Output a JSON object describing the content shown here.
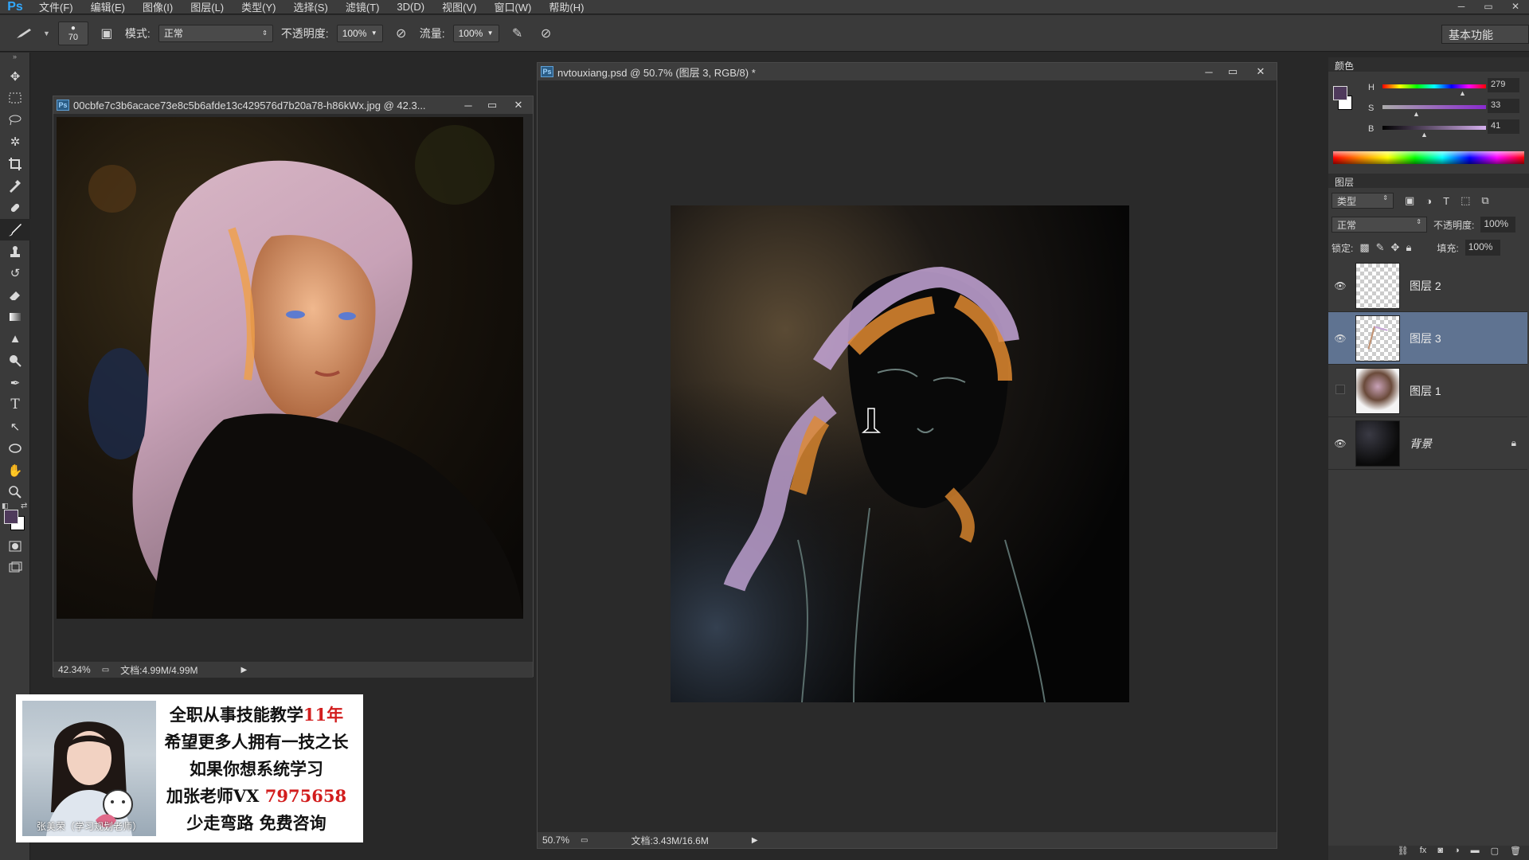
{
  "app": {
    "logo": "Ps"
  },
  "menu": [
    "文件(F)",
    "编辑(E)",
    "图像(I)",
    "图层(L)",
    "类型(Y)",
    "选择(S)",
    "滤镜(T)",
    "3D(D)",
    "视图(V)",
    "窗口(W)",
    "帮助(H)"
  ],
  "options": {
    "brush_size": "70",
    "mode_label": "模式:",
    "mode_value": "正常",
    "opacity_label": "不透明度:",
    "opacity_value": "100%",
    "flow_label": "流量:",
    "flow_value": "100%",
    "workspace": "基本功能"
  },
  "doc1": {
    "title": "00cbfe7c3b6acace73e8c5b6afde13c429576d7b20a78-h86kWx.jpg @ 42.3...",
    "zoom": "42.34%",
    "doc_info": "文档:4.99M/4.99M"
  },
  "doc2": {
    "title": "nvtouxiang.psd @ 50.7% (图层 3, RGB/8) *",
    "zoom": "50.7%",
    "doc_info": "文档:3.43M/16.6M"
  },
  "color_panel": {
    "tab": "颜色",
    "h_label": "H",
    "h_value": "279",
    "s_label": "S",
    "s_value": "33",
    "b_label": "B",
    "b_value": "41",
    "foreground": "#4f3a5c",
    "hsb": {
      "h": 279,
      "s": 33,
      "b": 41
    }
  },
  "layers_panel": {
    "tab": "图层",
    "filter_label": "类型",
    "blend_mode": "正常",
    "opacity_label": "不透明度:",
    "opacity_value": "100%",
    "lock_label": "锁定:",
    "fill_label": "填充:",
    "fill_value": "100%",
    "layers": [
      {
        "name": "图层 2",
        "visible": true,
        "selected": false
      },
      {
        "name": "图层 3",
        "visible": true,
        "selected": true
      },
      {
        "name": "图层 1",
        "visible": false,
        "selected": false
      },
      {
        "name": "背景",
        "visible": true,
        "selected": false,
        "locked": true
      }
    ]
  },
  "promo": {
    "caption": "张美荣（学习规划老师）",
    "line1": "全职从事技能教学",
    "line1_accent": "11年",
    "line2": "希望更多人拥有一技之长",
    "line3": "如果你想系统学习",
    "line4": "加张老师VX ",
    "line4_accent": "7975658",
    "line5": "少走弯路 免费咨询"
  }
}
